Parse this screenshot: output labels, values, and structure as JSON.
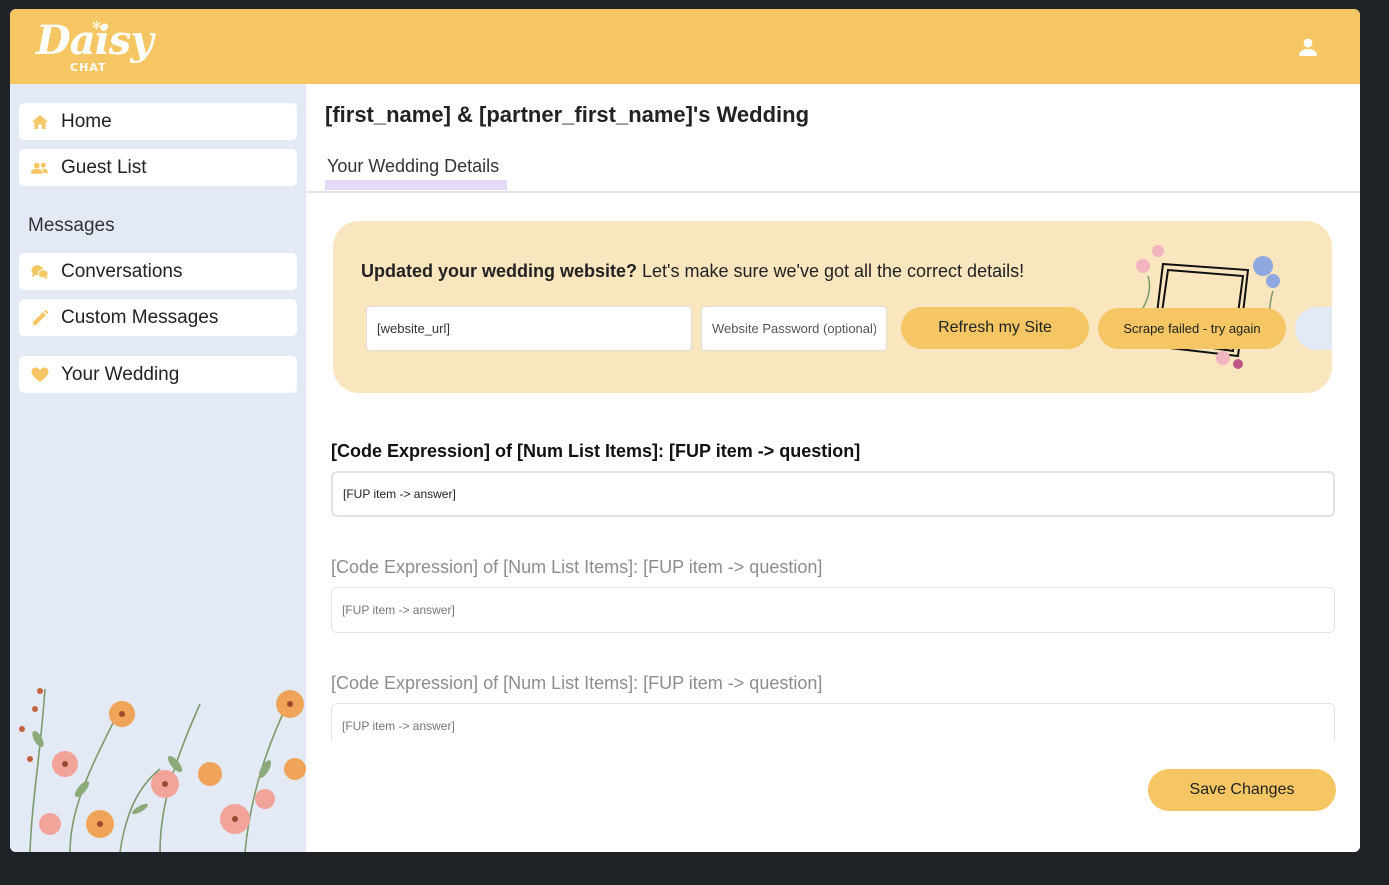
{
  "brand": {
    "logo_text": "Daisy",
    "logo_sub": "CHAT"
  },
  "header": {
    "user_icon": "user-icon"
  },
  "sidebar": {
    "items": [
      {
        "label": "Home",
        "icon": "home-icon"
      },
      {
        "label": "Guest List",
        "icon": "people-icon"
      },
      {
        "label": "Conversations",
        "icon": "chat-bubbles-icon"
      },
      {
        "label": "Custom Messages",
        "icon": "pencil-icon"
      },
      {
        "label": "Your Wedding",
        "icon": "heart-icon"
      }
    ],
    "section_messages": "Messages"
  },
  "main": {
    "title": "[first_name] & [partner_first_name]'s Wedding",
    "tabs": [
      {
        "label": "Your Wedding Details",
        "active": true
      }
    ]
  },
  "banner": {
    "headline_bold": "Updated your wedding website?",
    "headline_rest": " Let's make sure we've got all the correct details!",
    "url_value": "[website_url]",
    "password_placeholder": "Website Password (optional)",
    "refresh_label": "Refresh my Site",
    "status_label": "Scrape failed  - try again"
  },
  "questions": [
    {
      "question": "[Code Expression] of [Num List Items]: [FUP item -> question]",
      "answer": "[FUP item -> answer]"
    },
    {
      "question": "[Code Expression] of [Num List Items]: [FUP item -> question]",
      "answer": "[FUP item -> answer]"
    },
    {
      "question": "[Code Expression] of [Num List Items]: [FUP item -> question]",
      "answer": "[FUP item -> answer]"
    }
  ],
  "footer": {
    "save_label": "Save Changes"
  },
  "colors": {
    "accent": "#f5c663",
    "sidebar_bg": "#e4e9f6",
    "banner_bg": "#f9e6bf",
    "tab_underline": "#e5d9f7",
    "backdrop": "#1f2327"
  }
}
